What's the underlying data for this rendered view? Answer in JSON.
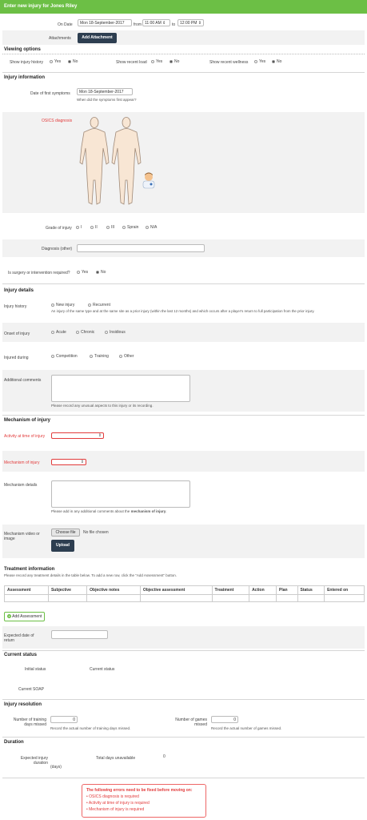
{
  "header": {
    "title": "Enter new injury for Jones Riley"
  },
  "ondate": {
    "label": "On Date",
    "date": "Mon 18-September-2017",
    "from_label": "from",
    "from_time": "11:00 AM",
    "to_label": "to",
    "to_time": "12:00 PM"
  },
  "attachments": {
    "label": "Attachments",
    "button": "Add Attachment"
  },
  "viewing": {
    "title": "Viewing options",
    "injury_history": "Show injury history",
    "recent_load": "Show recent load",
    "recent_wellness": "Show recent wellness",
    "yes": "Yes",
    "no": "No"
  },
  "injury_info": {
    "title": "Injury information",
    "first_symptoms_label": "Date of first symptoms",
    "first_symptoms_value": "Mon 18-September-2017",
    "first_symptoms_help": "When did the symptoms first appear?",
    "osics_label": "OSICS diagnosis",
    "body_icons": {
      "front": "human-body-front-icon",
      "back": "human-body-back-icon",
      "doctor": "doctor-icon"
    },
    "grade_label": "Grade of injury",
    "grades": [
      "I",
      "II",
      "III",
      "Sprain",
      "N/A"
    ],
    "diagnosis_other_label": "Diagnosis (other)",
    "surgery_label": "Is surgery or intervention required?",
    "yes": "Yes",
    "no": "No"
  },
  "injury_details": {
    "title": "Injury details",
    "history_label": "Injury history",
    "history_options": [
      "New injury",
      "Recurrent"
    ],
    "history_help": "An injury of the same type and at the same site as a prior injury (within the last 12 months) and which occurs after a player's return to full participation from the prior injury.",
    "onset_label": "Onset of injury",
    "onset_options": [
      "Acute",
      "Chronic",
      "Insidious"
    ],
    "during_label": "Injured during",
    "during_options": [
      "Competition",
      "Training",
      "Other"
    ],
    "comments_label": "Additional comments",
    "comments_help": "Please record any unusual aspects to this injury or its recording."
  },
  "mechanism": {
    "title": "Mechanism of injury",
    "activity_label": "Activity at time of injury",
    "mechanism_label": "Mechanism of injury",
    "details_label": "Mechanism details",
    "details_help_pre": "Please add in any additional comments about the ",
    "details_help_bold": "mechanism of injury",
    "details_help_post": ".",
    "video_label": "Mechanism video or image",
    "choose_file": "Choose file",
    "no_file": "No file chosen",
    "upload": "Upload"
  },
  "treatment": {
    "title": "Treatment information",
    "help": "Please record any treatment details in the table below. To add a new row, click the \"Add Assessment\" button.",
    "columns": [
      "Assessment",
      "Subjective",
      "Objective notes",
      "Objective assessment",
      "Treatment",
      "Action",
      "Plan",
      "Status",
      "Entered on"
    ],
    "add_button": "Add Assessment",
    "return_label": "Expected date of return"
  },
  "current_status": {
    "title": "Current status",
    "initial_label": "Initial status",
    "current_label": "Current status",
    "soap_label": "Current SOAP"
  },
  "resolution": {
    "title": "Injury resolution",
    "training_label": "Number of training days missed",
    "training_value": "0",
    "training_help": "Record the actual number of training days missed.",
    "games_label": "Number of games missed",
    "games_value": "0",
    "games_help": "Record the actual number of games missed."
  },
  "duration": {
    "title": "Duration",
    "expected_label": "Expected injury duration",
    "expected_unit": "(days)",
    "total_label": "Total days unavailable",
    "total_value": "0"
  },
  "errors": {
    "title": "The following errors need to be fixed before moving on:",
    "items": [
      "OSICS diagnosis is required",
      "Activity at time of injury is required",
      "Mechanism of injury is required"
    ]
  },
  "colors": {
    "header": "#6cbf45",
    "error": "#e23b3b",
    "dark_button": "#2d3e50"
  }
}
